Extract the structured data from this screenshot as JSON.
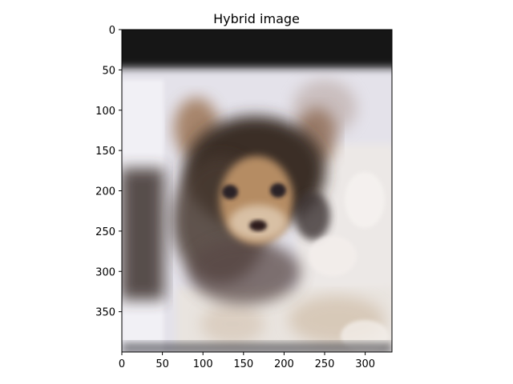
{
  "chart_data": {
    "type": "image",
    "title": "Hybrid image",
    "xlabel": "",
    "ylabel": "",
    "image_width": 333,
    "image_height": 400,
    "xlim": [
      0,
      333
    ],
    "ylim": [
      400,
      0
    ],
    "x_ticks": [
      0,
      50,
      100,
      150,
      200,
      250,
      300
    ],
    "y_ticks": [
      0,
      50,
      100,
      150,
      200,
      250,
      300,
      350
    ],
    "grid": false,
    "legend": "none",
    "image_description": "blurred blend of a puppy's face over a lighter textured background",
    "colors": {
      "dark_band": "#141414",
      "background_light": "#e2e0ea",
      "fur_dark": "#3a2c26",
      "fur_tan": "#b28a62",
      "floral_white": "#efeae6"
    }
  }
}
